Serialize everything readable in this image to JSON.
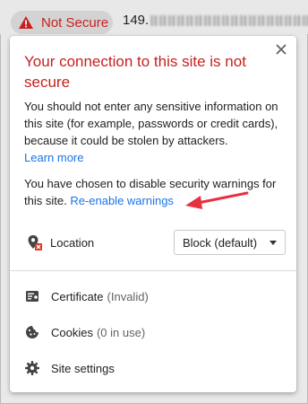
{
  "address_bar": {
    "security_chip_text": "Not Secure",
    "url_visible": "149."
  },
  "popup": {
    "title": "Your connection to this site is not secure",
    "warning_text": "You should not enter any sensitive information on this site (for example, passwords or credit cards), because it could be stolen by attackers.",
    "learn_more": "Learn more",
    "disabled_text": "You have chosen to disable security warnings for this site.",
    "reenable_link": "Re-enable warnings",
    "location_label": "Location",
    "location_select_value": "Block (default)",
    "certificate_label": "Certificate",
    "certificate_status": "(Invalid)",
    "cookies_label": "Cookies",
    "cookies_status": "(0 in use)",
    "site_settings_label": "Site settings"
  },
  "colors": {
    "danger": "#c5221f",
    "link": "#1a73e8",
    "annotation_arrow": "#e8303f"
  },
  "icons": [
    "warning-triangle-icon",
    "close-icon",
    "location-blocked-icon",
    "certificate-icon",
    "cookie-icon",
    "gear-icon",
    "annotation-arrow"
  ]
}
